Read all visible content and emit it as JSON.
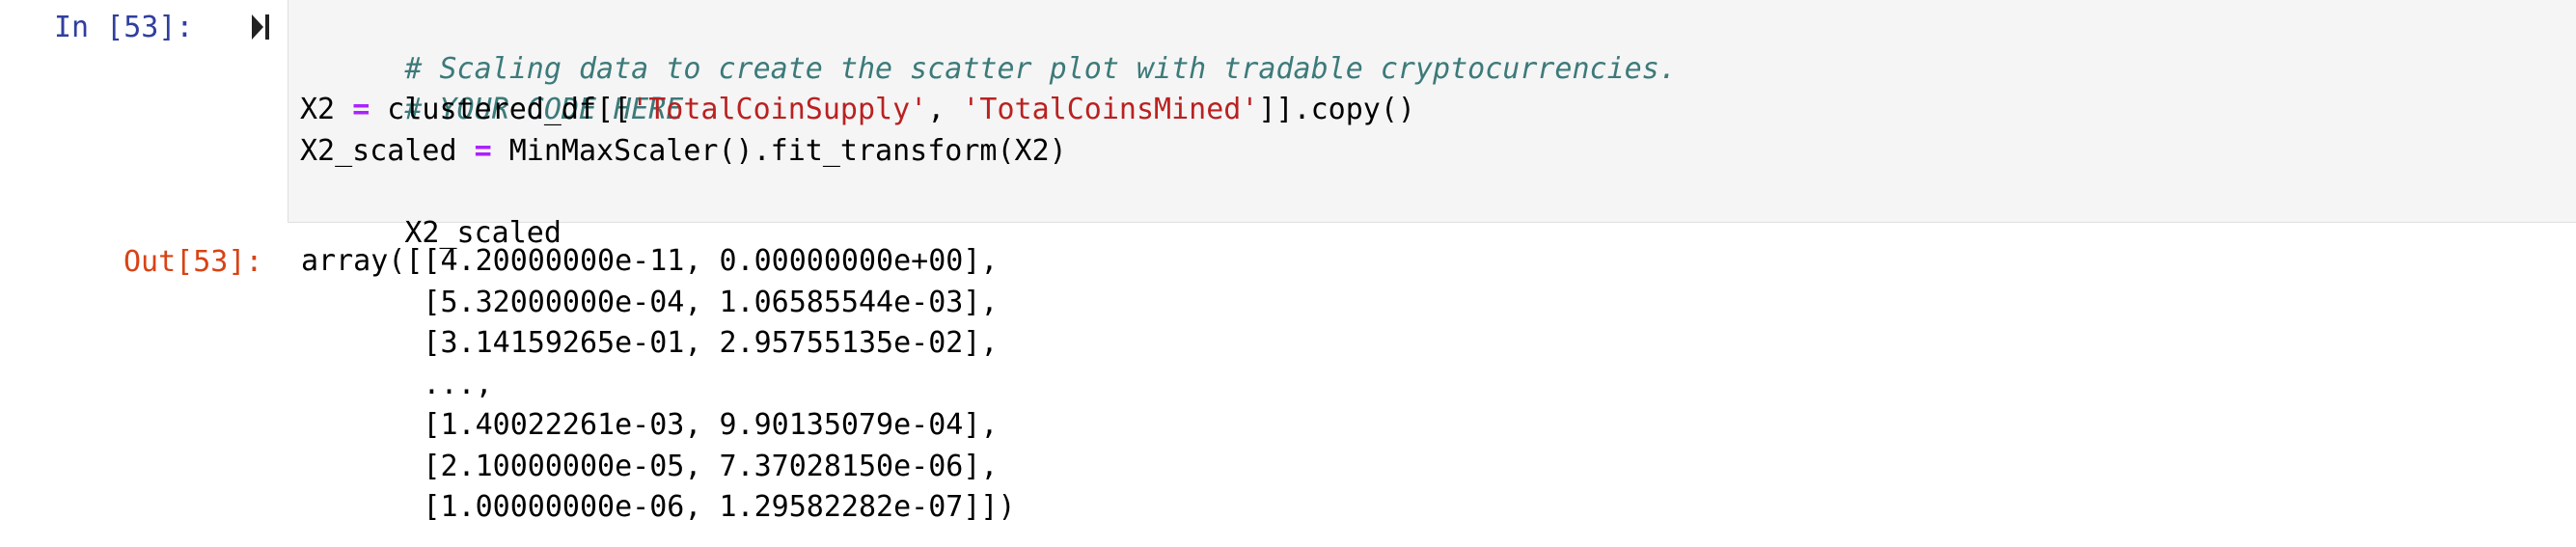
{
  "input": {
    "prompt": "In [53]:",
    "run_icon": "run-cell-icon",
    "comment_1": "# Scaling data to create the scatter plot with tradable cryptocurrencies.",
    "comment_2": "# YOUR CODE HERE",
    "line3": {
      "a": "X2 ",
      "op": "=",
      "b": " clustered_df[[",
      "s1": "'TotalCoinSupply'",
      "c": ", ",
      "s2": "'TotalCoinsMined'",
      "d": "]].copy()"
    },
    "line4": {
      "a": "X2_scaled ",
      "op": "=",
      "b": " MinMaxScaler().fit_transform(X2)"
    },
    "line5": "X2_scaled"
  },
  "output": {
    "prompt": "Out[53]:",
    "lines": [
      "array([[4.20000000e-11, 0.00000000e+00],",
      "       [5.32000000e-04, 1.06585544e-03],",
      "       [3.14159265e-01, 2.95755135e-02],",
      "       ...,",
      "       [1.40022261e-03, 9.90135079e-04],",
      "       [2.10000000e-05, 7.37028150e-06],",
      "       [1.00000000e-06, 1.29582282e-07]])"
    ]
  },
  "colors": {
    "in_prompt": "#303f9f",
    "out_prompt": "#d84315",
    "comment": "#3d7a7a",
    "operator": "#aa22ff",
    "string": "#ba2121",
    "input_bg": "#f5f5f5"
  }
}
